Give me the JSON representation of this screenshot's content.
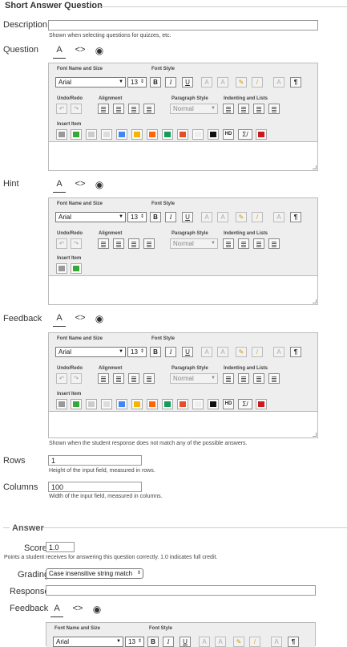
{
  "section": {
    "title": "Short Answer Question"
  },
  "description": {
    "label": "Description",
    "help": "Shown when selecting questions for quizzes, etc.",
    "value": ""
  },
  "question": {
    "label": "Question"
  },
  "hint": {
    "label": "Hint"
  },
  "feedback": {
    "label": "Feedback",
    "help": "Shown when the student response does not match any of the possible answers."
  },
  "rows": {
    "label": "Rows",
    "value": "1",
    "help": "Height of the input field, measured in rows."
  },
  "columns": {
    "label": "Columns",
    "value": "100",
    "help": "Width of the input field, measured in columns."
  },
  "answer": {
    "title": "Answer",
    "score_label": "Score",
    "score_value": "1.0",
    "score_help": "Points a student receives for answering this question correctly. 1.0 indicates full credit.",
    "grading_label": "Grading",
    "grading_value": "Case insensitive string match",
    "response_label": "Response",
    "response_value": "",
    "feedback_label": "Feedback"
  },
  "editor": {
    "font_name_label": "Font Name and Size",
    "font_name": "Arial",
    "font_size": "13",
    "font_style_label": "Font Style",
    "bold": "B",
    "italic": "I",
    "underline": "U",
    "sub": "A",
    "sup": "A",
    "undo_label": "Undo/Redo",
    "align_label": "Alignment",
    "para_label": "Paragraph Style",
    "para_value": "Normal",
    "indent_label": "Indenting and Lists",
    "insert_label": "Insert Item",
    "hd_label": "HD",
    "sigma_label": "Σ/",
    "pilcrow": "¶",
    "mode_rich": "A",
    "mode_html": "<>",
    "mode_preview": "◉"
  },
  "colors": {
    "drive": "#f4b400",
    "sheets": "#0f9d58",
    "html5": "#e44d26",
    "youtube": "#cc181e",
    "docs": "#4285f4"
  }
}
